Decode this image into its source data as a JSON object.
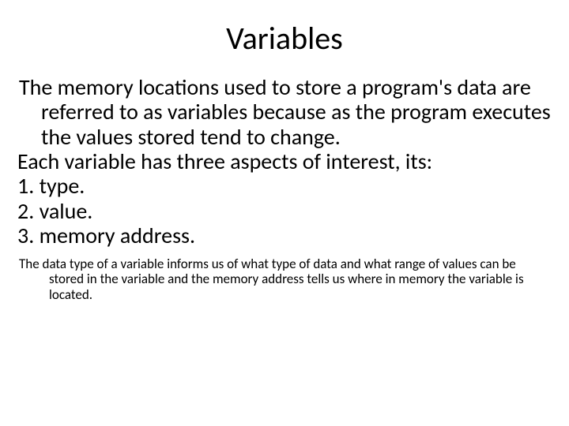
{
  "slide": {
    "title": "Variables",
    "para1": "The memory locations used to store a program's data are referred to as variables because as the program executes the values stored tend to change.",
    "para2": "Each variable has three aspects of interest, its:",
    "item1": "1. type.",
    "item2": "2. value.",
    "item3": "3. memory address.",
    "footnote": "The data type of a variable informs us of what type of data and what range of values can be stored in the variable and the memory address tells us where in memory the variable is located."
  }
}
